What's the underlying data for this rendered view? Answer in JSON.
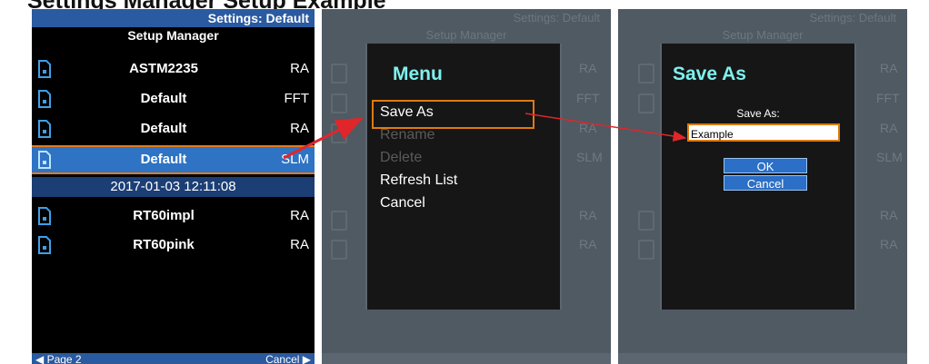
{
  "caption": "Settings Manager Setup Example",
  "panel1": {
    "settings_label": "Settings: Default",
    "title": "Setup Manager",
    "rows": [
      {
        "name": "ASTM2235",
        "type": "RA"
      },
      {
        "name": "Default",
        "type": "FFT"
      },
      {
        "name": "Default",
        "type": "RA"
      },
      {
        "name": "Default",
        "type": "SLM"
      },
      {
        "name": "RT60impl",
        "type": "RA"
      },
      {
        "name": "RT60pink",
        "type": "RA"
      }
    ],
    "selected_date": "2017-01-03 12:11:08",
    "bottom_left": "◀ Page 2",
    "bottom_right": "Cancel ▶"
  },
  "panel2": {
    "settings_label": "Settings: Default",
    "title": "Setup Manager",
    "ghost_types": [
      "RA",
      "FFT",
      "RA",
      "SLM",
      "RA",
      "RA"
    ],
    "menu": {
      "title": "Menu",
      "items": [
        {
          "label": "Save As",
          "enabled": true
        },
        {
          "label": "Rename",
          "enabled": false
        },
        {
          "label": "Delete",
          "enabled": false
        },
        {
          "label": "Refresh List",
          "enabled": true
        },
        {
          "label": "Cancel",
          "enabled": true
        }
      ]
    }
  },
  "panel3": {
    "settings_label": "Settings: Default",
    "title": "Setup Manager",
    "ghost_types": [
      "RA",
      "FFT",
      "RA",
      "SLM",
      "RA",
      "RA"
    ],
    "dialog": {
      "title": "Save As",
      "field_label": "Save As:",
      "field_value": "Example",
      "ok_label": "OK",
      "cancel_label": "Cancel"
    }
  },
  "colors": {
    "accent_orange": "#e07a10",
    "header_blue": "#2a5aa0",
    "selected_blue": "#2e73c4",
    "menu_title": "#7ff0ee",
    "arrow_red": "#e0262a"
  }
}
